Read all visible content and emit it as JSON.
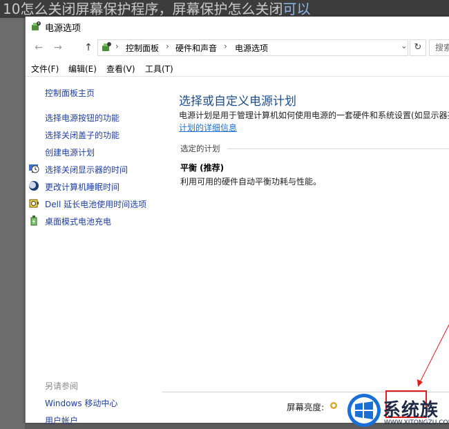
{
  "background": {
    "banner_text": "10怎么关闭屏幕保护程序，屏幕保护怎么关闭",
    "banner_accent": "可以"
  },
  "window": {
    "title": "电源选项"
  },
  "nav": {
    "back": "←",
    "forward": "→",
    "up": "↑",
    "dropdown": "⌄",
    "refresh": "↻",
    "search_placeholder": "搜索"
  },
  "breadcrumb": {
    "items": [
      "控制面板",
      "硬件和声音",
      "电源选项"
    ],
    "separator": "›"
  },
  "menu": {
    "items": [
      "文件(F)",
      "编辑(E)",
      "查看(V)",
      "工具(T)"
    ]
  },
  "sidebar": {
    "home": "控制面板主页",
    "links": [
      {
        "label": "选择电源按钮的功能",
        "icon": "none"
      },
      {
        "label": "选择关闭盖子的功能",
        "icon": "none"
      },
      {
        "label": "创建电源计划",
        "icon": "none"
      },
      {
        "label": "选择关闭显示器的时间",
        "icon": "monitor-clock-icon"
      },
      {
        "label": "更改计算机睡眠时间",
        "icon": "moon-icon"
      },
      {
        "label": "Dell 延长电池使用时间选项",
        "icon": "dell-battery-icon"
      },
      {
        "label": "桌面模式电池充电",
        "icon": "battery-plug-icon"
      }
    ],
    "see_also": "另请参阅",
    "see_also_links": [
      "Windows 移动中心",
      "用户帐户"
    ]
  },
  "main": {
    "heading": "选择或自定义电源计划",
    "description": "电源计划是用于管理计算机如何使用电源的一套硬件和系统设置(如显示器亮",
    "link": "计划的详细信息",
    "section_label": "选定的计划",
    "plan_name": "平衡 (推荐)",
    "plan_description": "利用可用的硬件自动平衡功耗与性能。",
    "brightness_label": "屏幕亮度:"
  },
  "watermark": {
    "name": "系统族",
    "url": "WWW.XITONGZU.COM"
  },
  "colors": {
    "link": "#1f3f9e",
    "heading": "#1e4e8c",
    "annotation": "#e21d1d"
  }
}
